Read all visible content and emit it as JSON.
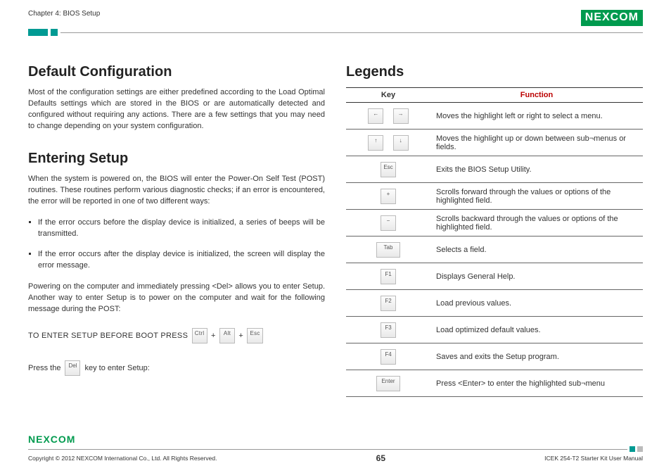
{
  "header": {
    "chapter": "Chapter 4: BIOS Setup",
    "logo_text": "NE COM",
    "logo_x": "X"
  },
  "left": {
    "h1": "Default Configuration",
    "p1": "Most of the configuration settings are either predefined according to the Load Optimal Defaults settings which are stored in the BIOS or are automatically detected and configured without requiring any actions. There are a few settings that you may need to change depending on your system configuration.",
    "h2": "Entering Setup",
    "p2": "When the system is powered on, the BIOS will enter the Power-On Self Test (POST) routines. These routines perform various diagnostic checks; if an error is encountered, the error will be reported in one of two different ways:",
    "b1": "If the error occurs before the display device is initialized, a series of beeps will be transmitted.",
    "b2": "If the error occurs after the display device is initialized, the screen will display the error message.",
    "p3": "Powering on the computer and immediately pressing <Del> allows you to enter Setup. Another way to enter Setup is to power on the computer and wait for the following message during the POST:",
    "setup_label": "TO ENTER SETUP BEFORE BOOT PRESS",
    "plus": "+",
    "key_ctrl": "Ctrl",
    "key_alt": "Alt",
    "key_esc": "Esc",
    "press_pre": "Press the",
    "key_del": "Del",
    "press_post": "key to enter Setup:"
  },
  "right": {
    "title": "Legends",
    "th_key": "Key",
    "th_func": "Function",
    "rows": [
      {
        "k1": "←",
        "k2": "→",
        "f": "Moves the highlight left or right to select a menu."
      },
      {
        "k1": "↑",
        "k2": "↓",
        "f": "Moves the highlight up or down between sub¬menus or fields."
      },
      {
        "k1": "Esc",
        "f": "Exits the BIOS Setup Utility."
      },
      {
        "k1": "+",
        "f": "Scrolls forward through the values or options of the highlighted field."
      },
      {
        "k1": "−",
        "f": "Scrolls backward through the values or options of the highlighted field."
      },
      {
        "k1": "Tab",
        "wide": true,
        "f": "Selects a field."
      },
      {
        "k1": "F1",
        "f": "Displays General Help."
      },
      {
        "k1": "F2",
        "f": "Load previous values."
      },
      {
        "k1": "F3",
        "f": "Load optimized default values."
      },
      {
        "k1": "F4",
        "f": "Saves and exits the Setup program."
      },
      {
        "k1": "Enter",
        "wide": true,
        "f": "Press <Enter> to enter the highlighted sub¬menu"
      }
    ]
  },
  "footer": {
    "logo": "NEXCOM",
    "copyright": "Copyright © 2012 NEXCOM International Co., Ltd. All Rights Reserved.",
    "page": "65",
    "doc": "ICEK 254-T2 Starter Kit User Manual"
  }
}
